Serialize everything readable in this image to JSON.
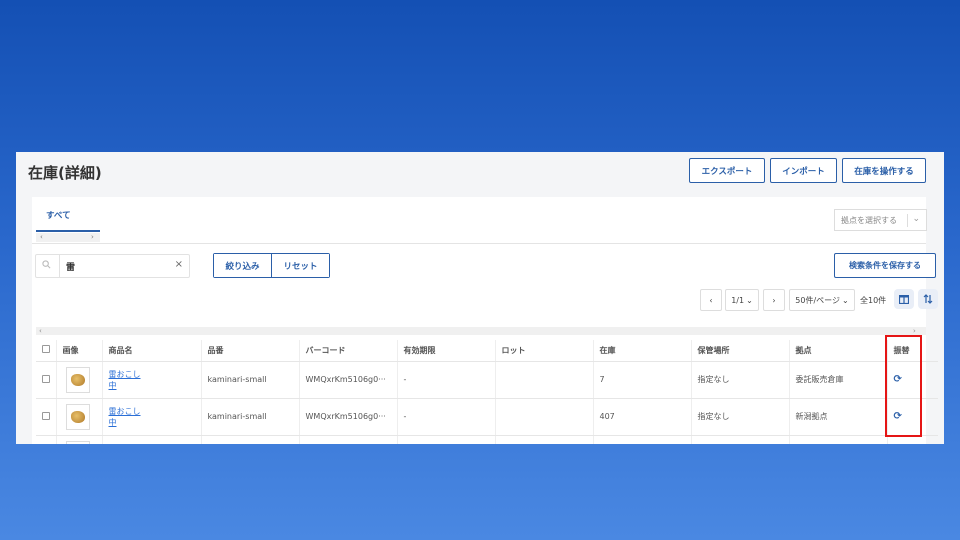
{
  "page": {
    "title": "在庫(詳細)",
    "header_buttons": [
      "エクスポート",
      "インポート",
      "在庫を操作する"
    ]
  },
  "tabs": {
    "active": "すべて",
    "scroll_left": "‹",
    "scroll_right": "›"
  },
  "location_select": {
    "placeholder": "拠点を選択する",
    "chevron": "⌄"
  },
  "filter": {
    "search_value": "雷",
    "search_icon": "search-icon",
    "clear": "×",
    "narrow_label": "絞り込み",
    "reset_label": "リセット",
    "save_conditions_label": "検索条件を保存する"
  },
  "pagination": {
    "prev": "‹",
    "page": "1/1",
    "page_chevron": "⌄",
    "next": "›",
    "per_page": "50件/ページ",
    "total": "全10件"
  },
  "table": {
    "columns": [
      "画像",
      "商品名",
      "品番",
      "バーコード",
      "有効期限",
      "ロット",
      "在庫",
      "保管場所",
      "拠点",
      "振替"
    ],
    "rows": [
      {
        "name_l1": "雷おこし",
        "name_l2": "中",
        "sku": "kaminari-small",
        "barcode": "WMQxrKm5106g0···",
        "expiry": "-",
        "lot": "",
        "stock": "7",
        "storage": "指定なし",
        "location": "委託販売倉庫"
      },
      {
        "name_l1": "雷おこし",
        "name_l2": "中",
        "sku": "kaminari-small",
        "barcode": "WMQxrKm5106g0···",
        "expiry": "-",
        "lot": "",
        "stock": "407",
        "storage": "指定なし",
        "location": "新潟拠点"
      }
    ]
  },
  "colors": {
    "accent": "#2b5fa8",
    "link": "#2b6fd6",
    "highlight": "#e51515"
  }
}
